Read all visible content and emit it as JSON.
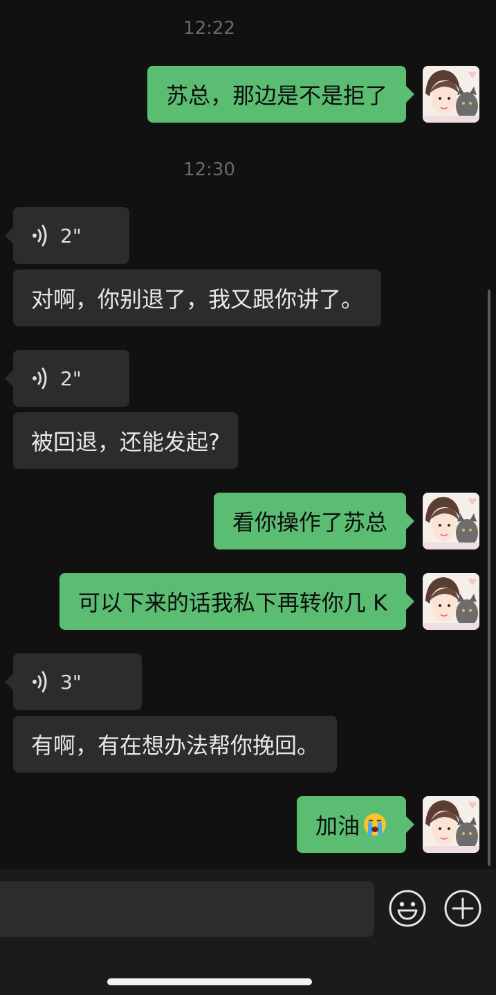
{
  "chat": {
    "time_1": "12:22",
    "time_2": "12:30",
    "messages": [
      {
        "type": "text",
        "text": "苏总，那边是不是拒了"
      },
      {
        "type": "voice",
        "duration": "2\""
      },
      {
        "type": "text",
        "text": "对啊，你别退了，我又跟你讲了。"
      },
      {
        "type": "voice",
        "duration": "2\""
      },
      {
        "type": "text",
        "text": "被回退，还能发起?"
      },
      {
        "type": "text",
        "text": "看你操作了苏总"
      },
      {
        "type": "text",
        "text": "可以下来的话我私下再转你几 K"
      },
      {
        "type": "voice",
        "duration": "3\""
      },
      {
        "type": "text",
        "text": "有啊，有在想办法帮你挽回。"
      },
      {
        "type": "text",
        "text": "加油",
        "emoji": "loudly-crying-face"
      }
    ]
  },
  "colors": {
    "background": "#111111",
    "outgoing_bubble": "#5bbd72",
    "incoming_bubble": "#2c2c2c"
  },
  "input_bar": {
    "emoji_button_icon": "smiley-icon",
    "more_button_icon": "plus-circle-icon"
  }
}
